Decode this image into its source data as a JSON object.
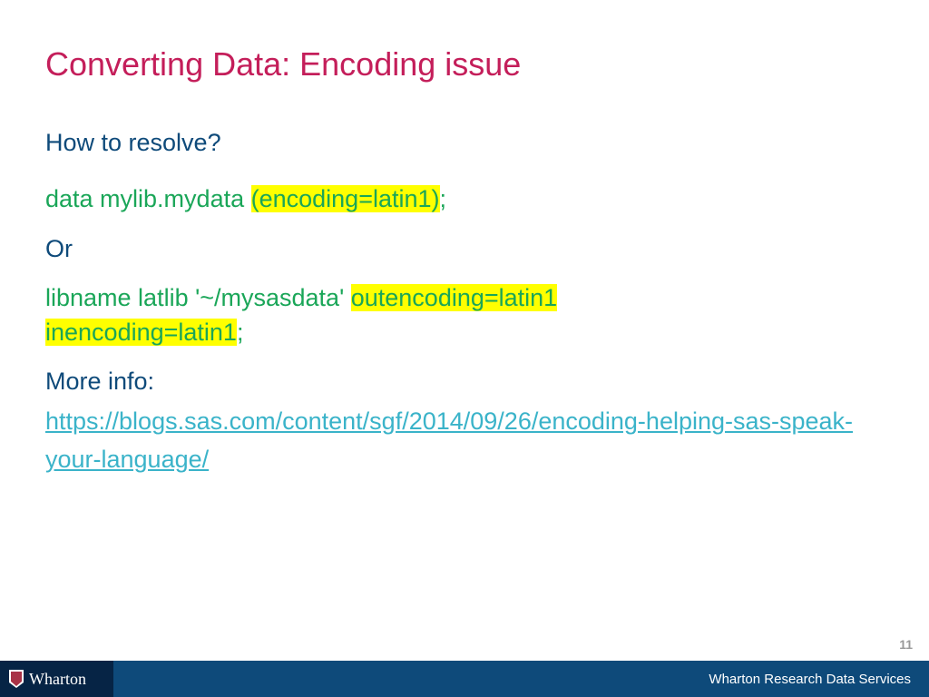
{
  "title": "Converting Data: Encoding issue",
  "subtitle": "How to resolve?",
  "code1": {
    "prefix": "data mylib.mydata ",
    "highlighted": "(encoding=latin1)",
    "suffix": ";"
  },
  "or": "Or",
  "code2": {
    "prefix": "libname latlib '~/mysasdata' ",
    "highlighted1": "outencoding=latin1 ",
    "highlighted2": "inencoding=latin1",
    "suffix": ";"
  },
  "moreInfo": "More info:",
  "link": "https://blogs.sas.com/content/sgf/2014/09/26/encoding-helping-sas-speak-your-language/",
  "pageNumber": "11",
  "footer": {
    "logo": "Wharton",
    "text": "Wharton Research Data Services"
  }
}
